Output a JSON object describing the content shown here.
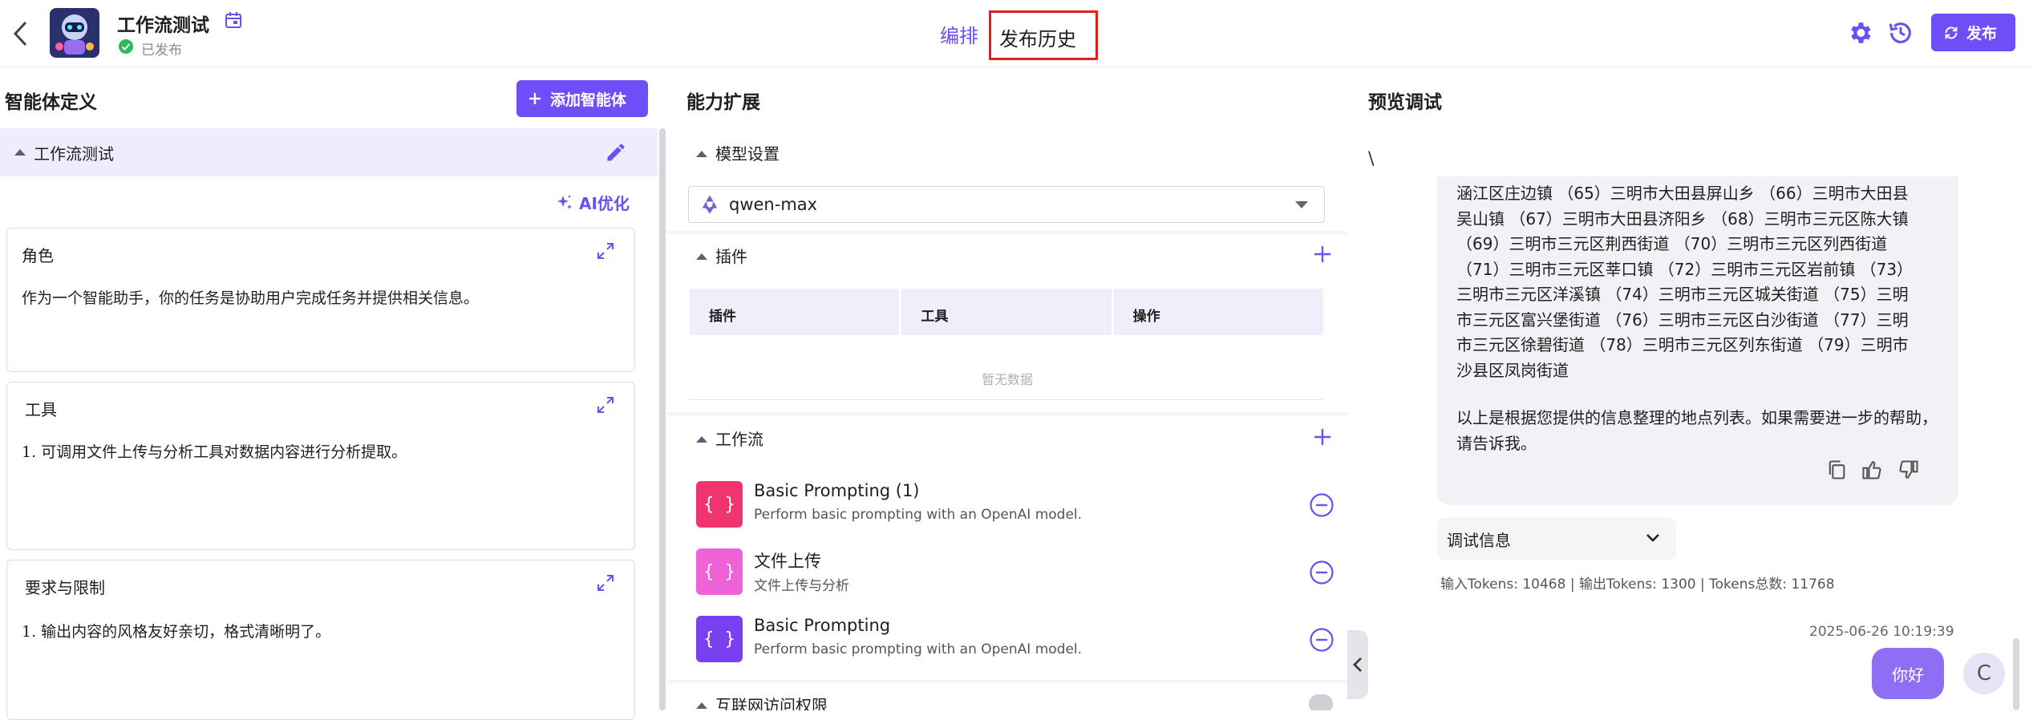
{
  "header": {
    "title": "工作流测试",
    "status": "已发布",
    "tab_edit": "编排",
    "tab_history": "发布历史",
    "publish_label": "发布",
    "accent_color": "#6d4ef7"
  },
  "left": {
    "title": "智能体定义",
    "add_agent_label": "添加智能体",
    "agent_name": "工作流测试",
    "ai_optimize_label": "AI优化",
    "cards": [
      {
        "title": "角色",
        "text": "作为一个智能助手，你的任务是协助用户完成任务并提供相关信息。"
      },
      {
        "title": "工具",
        "text": "1. 可调用文件上传与分析工具对数据内容进行分析提取。"
      },
      {
        "title": "要求与限制",
        "text": "1.   输出内容的风格友好亲切，格式清晰明了。"
      }
    ]
  },
  "middle": {
    "title": "能力扩展",
    "model_section": "模型设置",
    "model_value": "qwen-max",
    "plugin_section": "插件",
    "plugin_columns": [
      "插件",
      "工具",
      "操作"
    ],
    "plugin_empty": "暂无数据",
    "workflow_section": "工作流",
    "workflows": [
      {
        "name": "Basic Prompting (1)",
        "desc": "Perform basic prompting with an OpenAI model.",
        "icon": "{ }",
        "color": "#f0346f"
      },
      {
        "name": "文件上传",
        "desc": "文件上传与分析",
        "icon": "{ }",
        "color": "#f062d8"
      },
      {
        "name": "Basic Prompting",
        "desc": "Perform basic prompting with an OpenAI model.",
        "icon": "{ }",
        "color": "#7b3ff2"
      }
    ],
    "internet_section": "互联网访问权限"
  },
  "right": {
    "title": "预览调试",
    "backslash": "\\",
    "message_lines": [
      "涵江区庄边镇 （65）三明市大田县屏山乡 （66）三明市大田县",
      "吴山镇 （67）三明市大田县济阳乡 （68）三明市三元区陈大镇",
      "（69）三明市三元区荆西街道 （70）三明市三元区列西街道",
      "（71）三明市三元区莘口镇 （72）三明市三元区岩前镇 （73）",
      "三明市三元区洋溪镇 （74）三明市三元区城关街道 （75）三明",
      "市三元区富兴堡街道 （76）三明市三元区白沙街道 （77）三明",
      "市三元区徐碧街道 （78）三明市三元区列东街道 （79）三明市",
      "沙县区凤岗街道"
    ],
    "message_footer": "以上是根据您提供的信息整理的地点列表。如果需要进一步的帮助，请告诉我。",
    "debug_label": "调试信息",
    "tokens": "输入Tokens: 10468 | 输出Tokens: 1300 | Tokens总数: 11768",
    "timestamp": "2025-06-26 10:19:39",
    "user_message": "你好",
    "user_initial": "C"
  }
}
